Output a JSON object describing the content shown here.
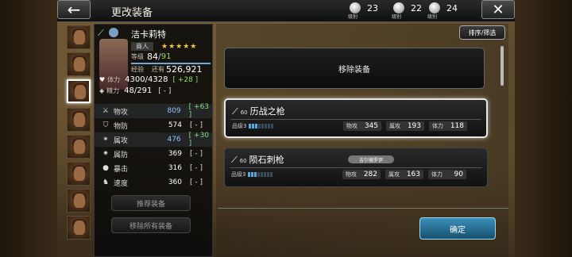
{
  "header": {
    "title": "更改装备",
    "back_icon": "back-arrow-icon",
    "close_icon": "close-x-icon",
    "currencies": [
      {
        "label": "级别",
        "value": "23"
      },
      {
        "label": "级别",
        "value": "22"
      },
      {
        "label": "级别",
        "value": "24"
      }
    ]
  },
  "character": {
    "name": "洁卡莉特",
    "job": "商人",
    "stars": "★★★★★",
    "level_label": "等级",
    "level": "84",
    "level_max": "91",
    "exp_label": "经验",
    "exp_remaining_label": "还有",
    "exp_remaining": "526,921",
    "hp_label": "体力",
    "hp": "4300/4328",
    "hp_bonus": "[ +28 ]",
    "mp_label": "精力",
    "mp": "48/291",
    "mp_bonus": "[ - ]"
  },
  "stats": [
    {
      "name": "物攻",
      "value": "809",
      "bonus": "[ +63 ]",
      "positive": true
    },
    {
      "name": "物防",
      "value": "574",
      "bonus": "[ - ]",
      "positive": false
    },
    {
      "name": "属攻",
      "value": "476",
      "bonus": "[ +30 ]",
      "positive": true
    },
    {
      "name": "属防",
      "value": "369",
      "bonus": "[ - ]",
      "positive": false
    },
    {
      "name": "暴击",
      "value": "316",
      "bonus": "[ - ]",
      "positive": false
    },
    {
      "name": "速度",
      "value": "360",
      "bonus": "[ - ]",
      "positive": false
    }
  ],
  "buttons": {
    "recommend": "推荐装备",
    "remove_all": "移除所有装备",
    "sort_filter": "排序/筛选",
    "remove_equipment": "移除装备",
    "confirm": "确定"
  },
  "items": [
    {
      "level": "60",
      "name": "历战之枪",
      "grade": "品级3",
      "tag": "",
      "patk_label": "物攻",
      "patk": "345",
      "matk_label": "属攻",
      "matk": "193",
      "hp_label": "体力",
      "hp": "118",
      "selected": true
    },
    {
      "level": "60",
      "name": "陨石刺枪",
      "grade": "品级3",
      "tag": "吉尔德罗伊",
      "patk_label": "物攻",
      "patk": "282",
      "matk_label": "属攻",
      "matk": "163",
      "hp_label": "体力",
      "hp": "90",
      "selected": false
    }
  ],
  "colors": {
    "accent_blue": "#3b8fb7",
    "positive_green": "#7ee080",
    "star_gold": "#f5c542"
  }
}
